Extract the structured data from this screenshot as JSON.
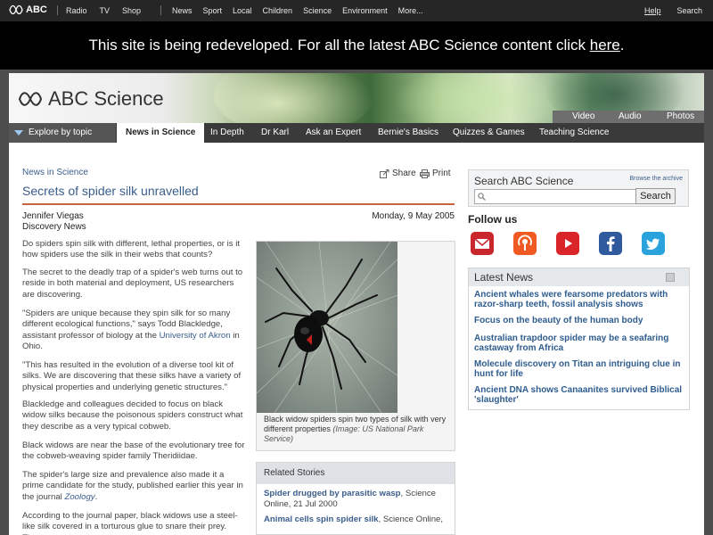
{
  "global_nav": {
    "logo": "ABC",
    "left_items": [
      "Radio",
      "TV",
      "Shop"
    ],
    "center_items": [
      "News",
      "Sport",
      "Local",
      "Children",
      "Science",
      "Environment",
      "More..."
    ],
    "help": "Help",
    "search": "Search"
  },
  "banner": {
    "text": "This site is being redeveloped. For all the latest ABC Science content click ",
    "link": "here",
    "end": "."
  },
  "header": {
    "brand": "ABC Science",
    "media": [
      "Video",
      "Audio",
      "Photos"
    ]
  },
  "section_nav": {
    "explore": "Explore by topic",
    "tabs": [
      "News in Science",
      "In Depth",
      "Dr Karl",
      "Ask an Expert",
      "Bernie's Basics",
      "Quizzes & Games",
      "Teaching Science"
    ],
    "active": "News in Science"
  },
  "article": {
    "kicker": "News in Science",
    "share": "Share",
    "print": "Print",
    "title": "Secrets of spider silk unravelled",
    "author": "Jennifer Viegas",
    "outlet": "Discovery News",
    "date": "Monday, 9 May 2005",
    "p1": "Do spiders spin silk with different, lethal properties, or is it how spiders use the silk in their webs that counts?",
    "p2": "The secret to the deadly trap of a spider's web turns out to reside in both material and deployment, US researchers are discovering.",
    "p3a": "\"Spiders are unique because they spin silk for so many different ecological functions,\" says Todd Blackledge, assistant professor of biology at the ",
    "p3_link": "University of Akron",
    "p3b": " in Ohio.",
    "p4": "\"This has resulted in the evolution of a diverse tool kit of silks. We are discovering that these silks have a variety of physical properties and underlying genetic structures.\"",
    "p5": "Blackledge and colleagues decided to focus on black widow silks because the poisonous spiders construct what they describe as a very typical cobweb.",
    "p6": "Black widows are near the base of the evolutionary tree for the cobweb-weaving spider family Theridiidae.",
    "p7a": "The spider's large size and prevalence also made it a prime candidate for the study, published earlier this year in the journal ",
    "p7_link": "Zoology",
    "p7b": ".",
    "p8": "According to the journal paper, black widows use a steel-like silk covered in a torturous glue to snare their prey. They"
  },
  "figure": {
    "caption": "Black widow spiders spin two types of silk with very different properties ",
    "credit": "(Image: US National Park Service)"
  },
  "related": {
    "heading": "Related Stories",
    "items": [
      {
        "title": "Spider drugged by parasitic wasp",
        "meta": ", Science Online, 21 Jul 2000"
      },
      {
        "title": "Animal cells spin spider silk",
        "meta": ", Science Online,"
      }
    ]
  },
  "sidebar": {
    "search_label": "Search ABC Science",
    "browse": "Browse the archive",
    "search_button": "Search",
    "follow": "Follow us",
    "latest_heading": "Latest News",
    "latest": [
      "Ancient whales were fearsome predators with razor-sharp teeth, fossil analysis shows",
      "Focus on the beauty of the human body",
      "Australian trapdoor spider may be a seafaring castaway from Africa",
      "Molecule discovery on Titan an intriguing clue in hunt for life",
      "Ancient DNA shows Canaanites survived Biblical 'slaughter'"
    ]
  },
  "colors": {
    "link": "#3a5d8c",
    "rule": "#c9623f",
    "latest_link": "#2f5d8f",
    "social_email": "#c9262d",
    "social_podcast": "#f05a22",
    "social_youtube": "#d9252a",
    "social_facebook": "#2f5a9e",
    "social_twitter": "#2aa3dd"
  }
}
